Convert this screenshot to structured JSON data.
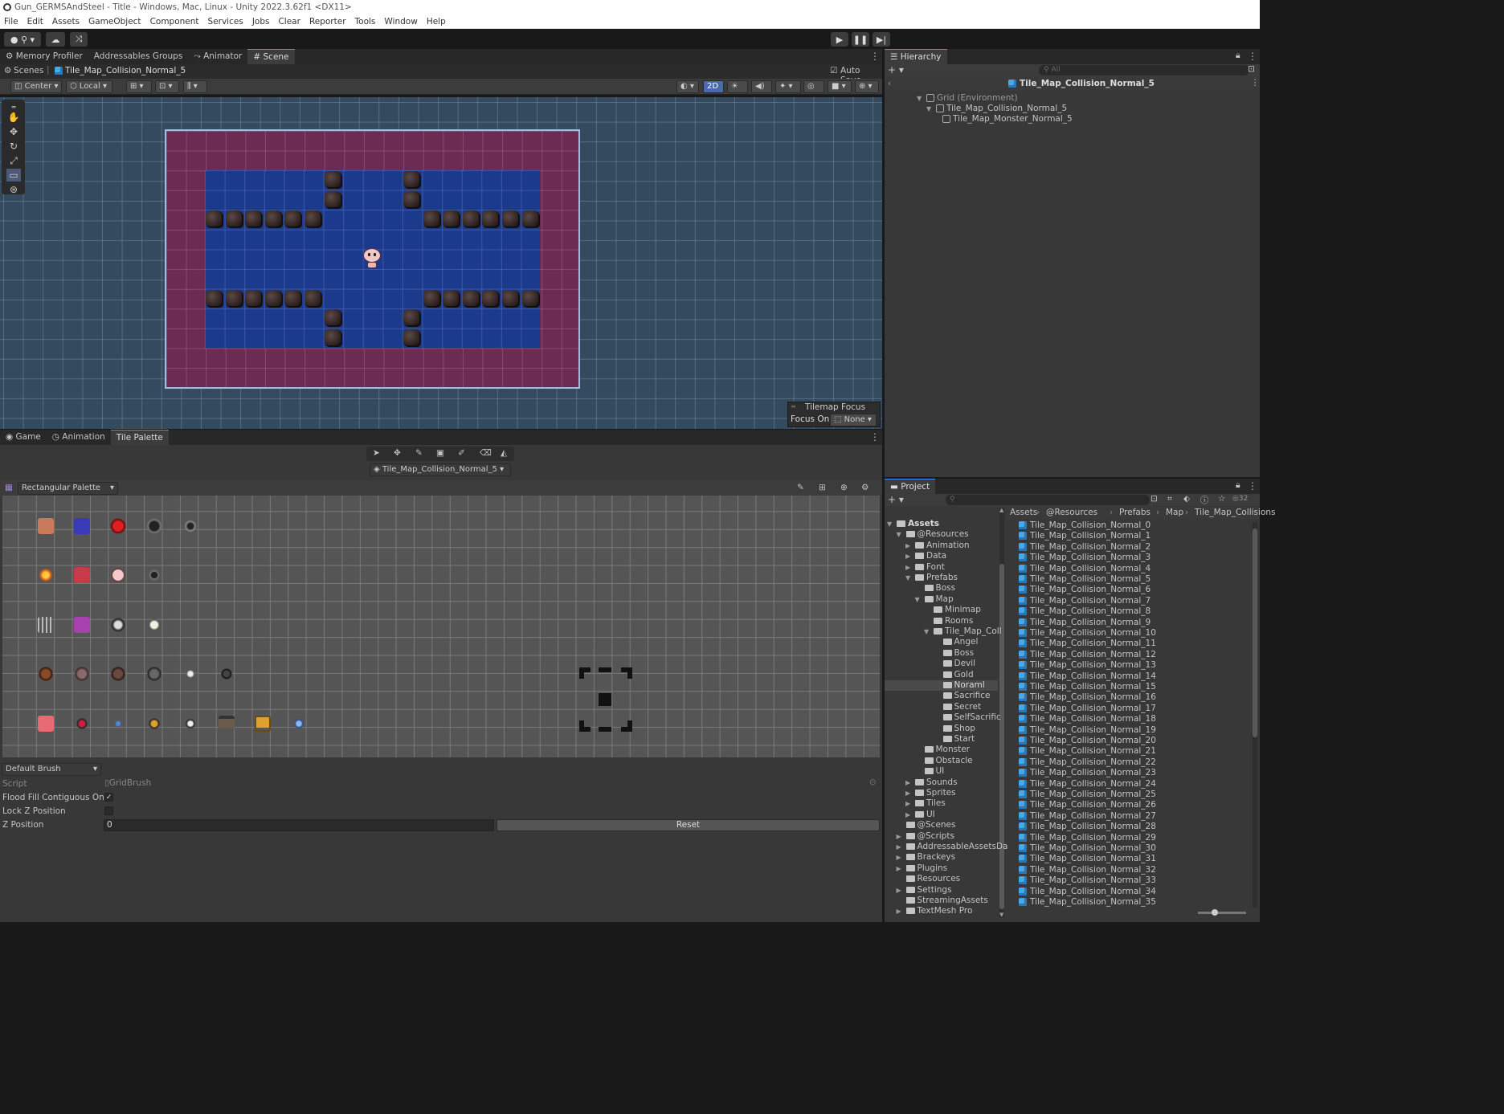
{
  "window": {
    "title": "Gun_GERMSAndSteel - Title - Windows, Mac, Linux - Unity 2022.3.62f1 <DX11>"
  },
  "menu": [
    "File",
    "Edit",
    "Assets",
    "GameObject",
    "Component",
    "Services",
    "Jobs",
    "Clear",
    "Reporter",
    "Tools",
    "Window",
    "Help"
  ],
  "toolbar": {
    "account_icon": "account-icon",
    "cloud_icon": "cloud-icon",
    "collab_icon": "version-control-icon",
    "play_icon": "play-icon",
    "pause_icon": "pause-icon",
    "step_icon": "step-icon"
  },
  "top_tabs": [
    {
      "label": "Memory Profiler",
      "icon": "gear-icon"
    },
    {
      "label": "Addressables Groups"
    },
    {
      "label": "Animator",
      "icon": "animator-icon"
    },
    {
      "label": "Scene",
      "icon": "grid-icon",
      "active": true
    }
  ],
  "scene": {
    "breadcrumb_root": "Scenes",
    "breadcrumb_item": "Tile_Map_Collision_Normal_5",
    "auto_save_label": "Auto Save",
    "auto_save_checked": true,
    "pivot_mode": "Center",
    "pivot_rotation": "Local",
    "mode_2d": "2D",
    "tilemap_focus_title": "Tilemap Focus",
    "focus_on_label": "Focus On",
    "focus_on_value": "None"
  },
  "bottom_tabs": [
    {
      "label": "Game",
      "icon": "gamepad-icon"
    },
    {
      "label": "Animation",
      "icon": "clock-icon"
    },
    {
      "label": "Tile Palette",
      "active": true
    }
  ],
  "tile_palette": {
    "tilemap_target": "Tile_Map_Collision_Normal_5",
    "palette_name": "Rectangular Palette",
    "brush": "Default Brush",
    "script_label": "Script",
    "script_value": "GridBrush",
    "flood_fill_label": "Flood Fill Contiguous Only",
    "flood_fill_checked": true,
    "lock_z_label": "Lock Z Position",
    "lock_z_checked": false,
    "z_position_label": "Z Position",
    "z_position_value": "0",
    "reset_label": "Reset"
  },
  "hierarchy": {
    "title": "Hierarchy",
    "search_placeholder": "All",
    "scene_name": "Tile_Map_Collision_Normal_5",
    "items": [
      {
        "label": "Grid (Environment)",
        "depth": 0
      },
      {
        "label": "Tile_Map_Collision_Normal_5",
        "depth": 1
      },
      {
        "label": "Tile_Map_Monster_Normal_5",
        "depth": 2
      }
    ]
  },
  "project": {
    "title": "Project",
    "breadcrumb": [
      "Assets",
      "@Resources",
      "Prefabs",
      "Map",
      "Tile_Map_Collisions"
    ],
    "visible_count": "32",
    "tree": [
      {
        "label": "Assets",
        "depth": 0,
        "open": true,
        "bold": true
      },
      {
        "label": "@Resources",
        "depth": 1,
        "open": true
      },
      {
        "label": "Animation",
        "depth": 2
      },
      {
        "label": "Data",
        "depth": 2
      },
      {
        "label": "Font",
        "depth": 2
      },
      {
        "label": "Prefabs",
        "depth": 2,
        "open": true
      },
      {
        "label": "Boss",
        "depth": 3,
        "leaf": true
      },
      {
        "label": "Map",
        "depth": 3,
        "open": true
      },
      {
        "label": "Minimap",
        "depth": 4,
        "leaf": true
      },
      {
        "label": "Rooms",
        "depth": 4,
        "leaf": true
      },
      {
        "label": "Tile_Map_Coll",
        "depth": 4,
        "open": true
      },
      {
        "label": "Angel",
        "depth": 5,
        "leaf": true
      },
      {
        "label": "Boss",
        "depth": 5,
        "leaf": true
      },
      {
        "label": "Devil",
        "depth": 5,
        "leaf": true
      },
      {
        "label": "Gold",
        "depth": 5,
        "leaf": true
      },
      {
        "label": "Noraml",
        "depth": 5,
        "leaf": true,
        "selected": true
      },
      {
        "label": "Sacrifice",
        "depth": 5,
        "leaf": true
      },
      {
        "label": "Secret",
        "depth": 5,
        "leaf": true
      },
      {
        "label": "SelfSacrific",
        "depth": 5,
        "leaf": true
      },
      {
        "label": "Shop",
        "depth": 5,
        "leaf": true
      },
      {
        "label": "Start",
        "depth": 5,
        "leaf": true
      },
      {
        "label": "Monster",
        "depth": 3,
        "leaf": true
      },
      {
        "label": "Obstacle",
        "depth": 3,
        "leaf": true
      },
      {
        "label": "UI",
        "depth": 3,
        "leaf": true
      },
      {
        "label": "Sounds",
        "depth": 2
      },
      {
        "label": "Sprites",
        "depth": 2
      },
      {
        "label": "Tiles",
        "depth": 2
      },
      {
        "label": "UI",
        "depth": 2
      },
      {
        "label": "@Scenes",
        "depth": 1,
        "leaf": true
      },
      {
        "label": "@Scripts",
        "depth": 1
      },
      {
        "label": "AddressableAssetsDa",
        "depth": 1
      },
      {
        "label": "Brackeys",
        "depth": 1
      },
      {
        "label": "Plugins",
        "depth": 1
      },
      {
        "label": "Resources",
        "depth": 1,
        "leaf": true
      },
      {
        "label": "Settings",
        "depth": 1
      },
      {
        "label": "StreamingAssets",
        "depth": 1,
        "leaf": true
      },
      {
        "label": "TextMesh Pro",
        "depth": 1
      }
    ],
    "files": [
      "Tile_Map_Collision_Normal_0",
      "Tile_Map_Collision_Normal_1",
      "Tile_Map_Collision_Normal_2",
      "Tile_Map_Collision_Normal_3",
      "Tile_Map_Collision_Normal_4",
      "Tile_Map_Collision_Normal_5",
      "Tile_Map_Collision_Normal_6",
      "Tile_Map_Collision_Normal_7",
      "Tile_Map_Collision_Normal_8",
      "Tile_Map_Collision_Normal_9",
      "Tile_Map_Collision_Normal_10",
      "Tile_Map_Collision_Normal_11",
      "Tile_Map_Collision_Normal_12",
      "Tile_Map_Collision_Normal_13",
      "Tile_Map_Collision_Normal_14",
      "Tile_Map_Collision_Normal_15",
      "Tile_Map_Collision_Normal_16",
      "Tile_Map_Collision_Normal_17",
      "Tile_Map_Collision_Normal_18",
      "Tile_Map_Collision_Normal_19",
      "Tile_Map_Collision_Normal_20",
      "Tile_Map_Collision_Normal_21",
      "Tile_Map_Collision_Normal_22",
      "Tile_Map_Collision_Normal_23",
      "Tile_Map_Collision_Normal_24",
      "Tile_Map_Collision_Normal_25",
      "Tile_Map_Collision_Normal_26",
      "Tile_Map_Collision_Normal_27",
      "Tile_Map_Collision_Normal_28",
      "Tile_Map_Collision_Normal_29",
      "Tile_Map_Collision_Normal_30",
      "Tile_Map_Collision_Normal_31",
      "Tile_Map_Collision_Normal_32",
      "Tile_Map_Collision_Normal_33",
      "Tile_Map_Collision_Normal_34",
      "Tile_Map_Collision_Normal_35"
    ]
  },
  "colors": {
    "accent": "#4a8ef0",
    "wall": "#6b2b52",
    "floor": "#1c3a8c",
    "scene_bg": "#344a5e",
    "asset_icon": "#4aa8e8"
  }
}
